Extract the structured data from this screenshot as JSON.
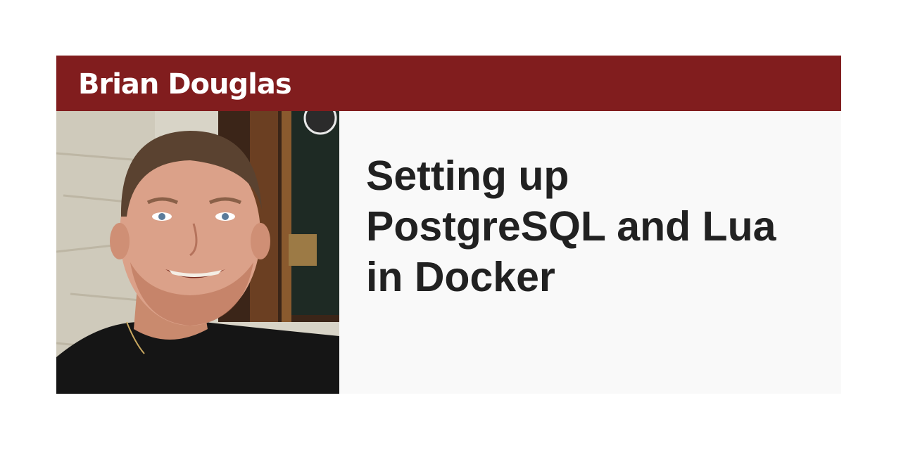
{
  "author": {
    "name": "Brian Douglas",
    "photo_icon": "author-portrait"
  },
  "post": {
    "title": "Setting up PostgreSQL and Lua in Docker"
  },
  "colors": {
    "banner": "#811d1e",
    "content_bg": "#f9f9f9",
    "title_text": "#212121",
    "name_text": "#ffffff"
  }
}
